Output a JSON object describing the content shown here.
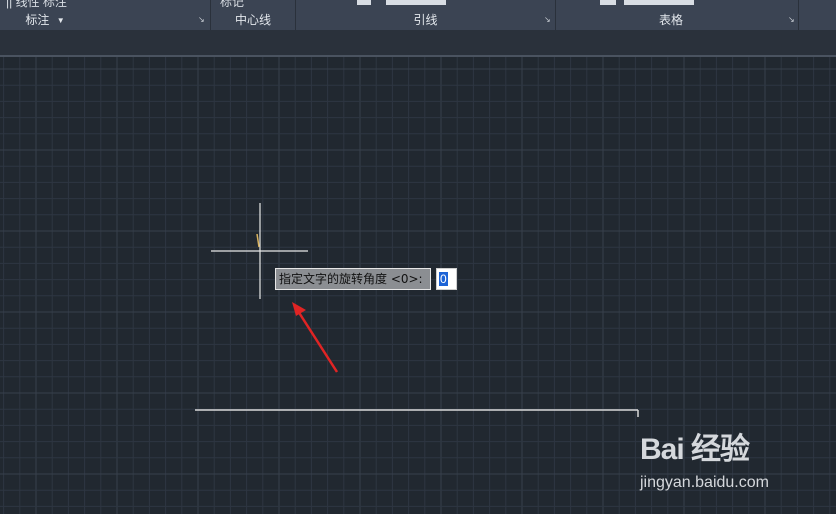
{
  "ribbon": {
    "panels": [
      {
        "title": "标注",
        "has_dropdown": true,
        "has_launcher": true
      },
      {
        "title": "中心线",
        "has_launcher": false
      },
      {
        "title": "引线",
        "has_launcher": true
      },
      {
        "title": "表格",
        "has_launcher": true
      }
    ],
    "clipped_row_text": {
      "left": "|| 线性  标注",
      "center_mark": "标记"
    }
  },
  "canvas": {
    "background_color": "#212830",
    "grid_color": "#2e3642",
    "grid_major_color": "#37404c",
    "crosshair_color": "#e8e8e8",
    "text_cursor_color": "#d8b25e",
    "line_color": "#d9d9d9",
    "arrow_color": "#e02424"
  },
  "dynamic_input": {
    "prompt": "指定文字的旋转角度 <0>:",
    "value": "0"
  },
  "watermark": {
    "brand": "Bai 经验",
    "url": "jingyan.baidu.com"
  }
}
